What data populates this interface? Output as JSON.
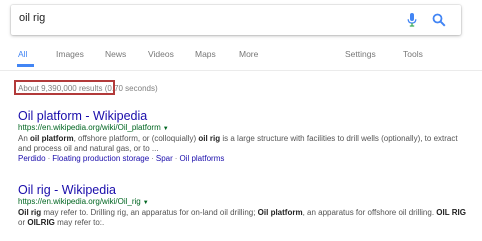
{
  "search": {
    "query": "oil rig"
  },
  "tabs": [
    {
      "label": "All"
    },
    {
      "label": "Images"
    },
    {
      "label": "News"
    },
    {
      "label": "Videos"
    },
    {
      "label": "Maps"
    },
    {
      "label": "More"
    }
  ],
  "settings_label": "Settings",
  "tools_label": "Tools",
  "stats": "About 9,390,000 results (0.70 seconds)",
  "results": [
    {
      "title": "Oil platform - Wikipedia",
      "url": "https://en.wikipedia.org/wiki/Oil_platform",
      "snippet": [
        {
          "t": "An ",
          "b": false
        },
        {
          "t": "oil platform",
          "b": true
        },
        {
          "t": ", offshore platform, or (colloquially) ",
          "b": false
        },
        {
          "t": "oil rig",
          "b": true
        },
        {
          "t": " is a large structure with facilities to drill wells (optionally), to extract and process oil and natural gas, or to ...",
          "b": false
        }
      ],
      "sitelinks": [
        "Perdido",
        "Floating production storage",
        "Spar",
        "Oil platforms"
      ]
    },
    {
      "title": "Oil rig - Wikipedia",
      "url": "https://en.wikipedia.org/wiki/Oil_rig",
      "snippet": [
        {
          "t": "Oil rig",
          "b": true
        },
        {
          "t": " may refer to. Drilling rig, an apparatus for on-land oil drilling; ",
          "b": false
        },
        {
          "t": "Oil platform",
          "b": true
        },
        {
          "t": ", an apparatus for offshore oil drilling. ",
          "b": false
        },
        {
          "t": "OIL RIG",
          "b": true
        },
        {
          "t": " or ",
          "b": false
        },
        {
          "t": "OILRIG",
          "b": true
        },
        {
          "t": " may refer to:.",
          "b": false
        }
      ],
      "sitelinks": []
    }
  ],
  "colors": {
    "link": "#1a0dab",
    "url": "#006621",
    "accent": "#4285f4",
    "highlight_box": "#b23a3a"
  },
  "icons": {
    "mic": "microphone-icon",
    "search": "search-icon"
  }
}
